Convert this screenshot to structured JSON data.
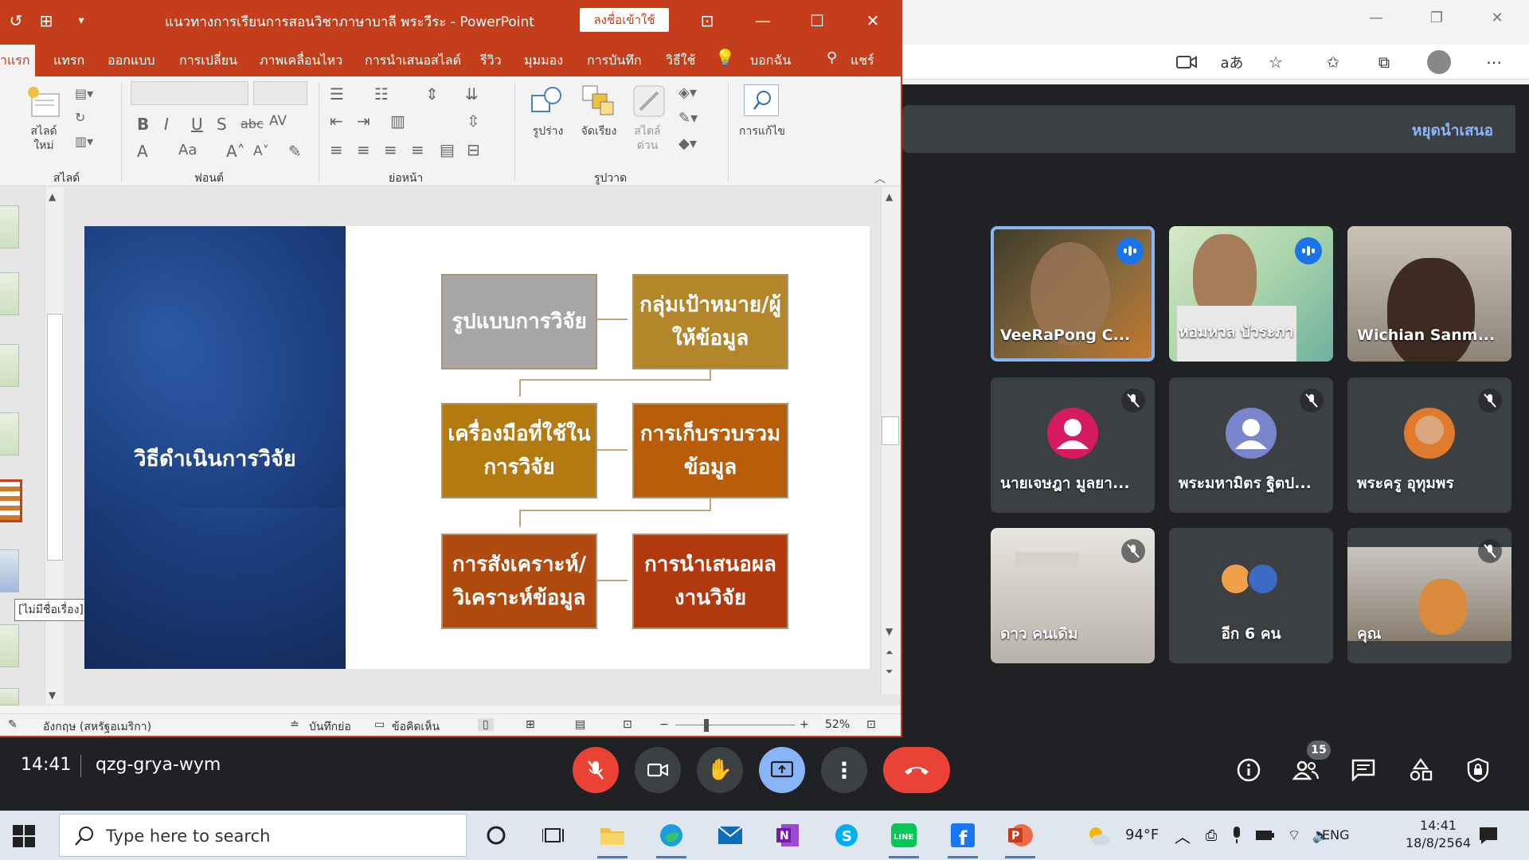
{
  "browser": {
    "stop_presenting": "หยุดนำเสนอ"
  },
  "participants": [
    {
      "name": "VeeRaPong C...",
      "state": "speaking"
    },
    {
      "name": "หอมหวล บัวระภา",
      "state": "speaking"
    },
    {
      "name": "Wichian Sanm...",
      "state": "none"
    },
    {
      "name": "นายเจษฎา มูลยา...",
      "state": "muted",
      "avatar_color": "#d81b60"
    },
    {
      "name": "พระมหามิตร ฐิตป...",
      "state": "muted",
      "avatar_color": "#7986cb"
    },
    {
      "name": "พระครู อุทุมพร",
      "state": "muted"
    },
    {
      "name": "ดาว คนเดิม",
      "state": "muted"
    },
    {
      "name": "อีก 6 คน",
      "state": "none"
    },
    {
      "name": "คุณ",
      "state": "muted"
    }
  ],
  "meet_bar": {
    "time": "14:41",
    "meeting_code": "qzg-grya-wym",
    "people_count": "15"
  },
  "ppt": {
    "window_title": "แนวทางการเรียนการสอนวิชาภาษาบาลี พระวีระ  -  PowerPoint",
    "signin": "ลงชื่อเข้าใช้",
    "tabs": [
      "แทรก",
      "ออกแบบ",
      "การเปลี่ยน",
      "ภาพเคลื่อนไหว",
      "การนำเสนอสไลด์",
      "รีวิว",
      "มุมมอง",
      "การบันทึก",
      "วิธีใช้",
      "บอกฉัน",
      "แชร์"
    ],
    "active_tab": "าแรก",
    "ribbon": {
      "new_slide": "สไลด์ใหม่",
      "slide_group": "สไลด์",
      "font_group": "ฟอนต์",
      "paragraph_group": "ย่อหน้า",
      "drawing_group": "รูปวาด",
      "shapes": "รูปร่าง",
      "arrange": "จัดเรียง",
      "styles": "สไตล์ด่วน",
      "editing": "การแก้ไข"
    },
    "tooltip": "[ไม่มีชื่อเรื่อง]",
    "slide": {
      "title": "วิธีดำเนินการวิจัย",
      "boxes": [
        {
          "text": "รูปแบบการวิจัย",
          "color": "#a6a6a6"
        },
        {
          "text": "กลุ่มเป้าหมาย/ผู้ให้ข้อมูล",
          "color": "#b3862a"
        },
        {
          "text": "เครื่องมือที่ใช้ในการวิจัย",
          "color": "#b37a0f"
        },
        {
          "text": "การเก็บรวบรวมข้อมูล",
          "color": "#b85d0a"
        },
        {
          "text": "การสังเคราะห์/วิเคราะห์ข้อมูล",
          "color": "#b14a0e"
        },
        {
          "text": "การนำเสนอผลงานวิจัย",
          "color": "#b2380d"
        }
      ]
    },
    "status": {
      "language": "อังกฤษ (สหรัฐอเมริกา)",
      "notes": "บันทึกย่อ",
      "comments": "ข้อคิดเห็น",
      "zoom": "52%"
    }
  },
  "taskbar": {
    "search_placeholder": "Type here to search",
    "temperature": "94°F",
    "language": "ENG",
    "time": "14:41",
    "date": "18/8/2564"
  }
}
